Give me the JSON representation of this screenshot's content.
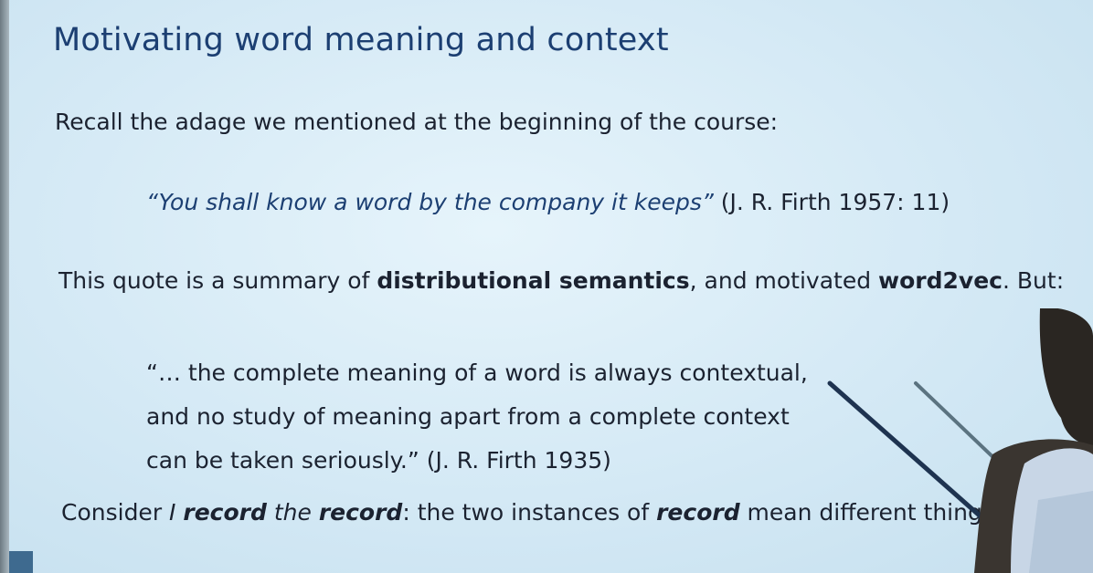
{
  "slide": {
    "title": "Motivating word meaning and context",
    "recall_text": "Recall the adage we mentioned at the beginning of the course:",
    "quote1": {
      "text": "“You shall know a word by the company it keeps”",
      "citation": " (J. R. Firth 1957: 11)"
    },
    "summary": {
      "part1": "This quote is a summary of ",
      "bold1": "distributional semantics",
      "part2": ", and motivated ",
      "bold2": "word2vec",
      "part3": ". But:"
    },
    "quote2": {
      "line1": "“… the complete meaning of a word is always contextual,",
      "line2": "and no study of meaning apart from a complete context",
      "line3": "can be taken seriously.” (J. R. Firth 1935)"
    },
    "consider": {
      "part1": "Consider ",
      "ital1": "I ",
      "boldital1": "record",
      "ital2": " the ",
      "boldital2": "record",
      "part2": ": the two instances of ",
      "boldital3": "record",
      "part3": " mean different things."
    }
  },
  "colors": {
    "title": "#1c3f72",
    "body_text": "#1b2230",
    "slide_bg": "#d4e9f5"
  }
}
